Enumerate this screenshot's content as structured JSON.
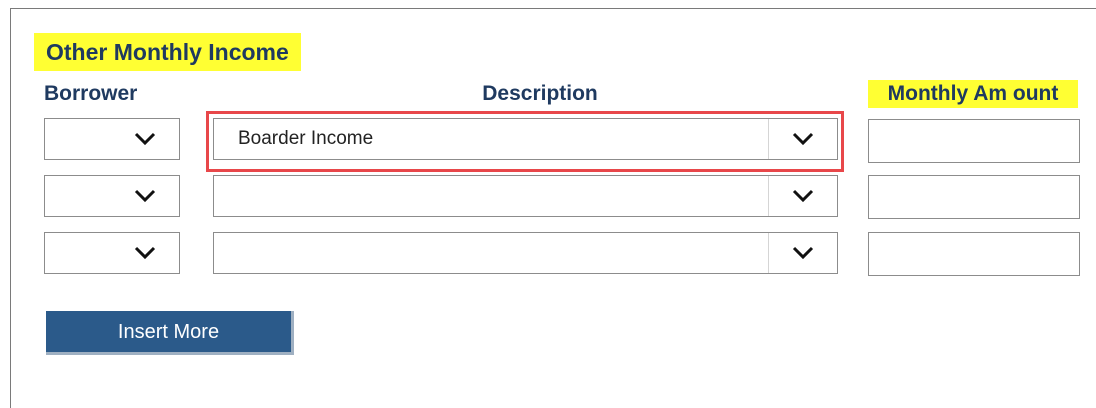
{
  "section": {
    "title": "Other Monthly Income"
  },
  "columns": {
    "borrower": "Borrower",
    "description": "Description",
    "monthly_amount": "Monthly Am ount"
  },
  "rows": [
    {
      "borrower": "",
      "description": "Boarder Income",
      "amount": ""
    },
    {
      "borrower": "",
      "description": "",
      "amount": ""
    },
    {
      "borrower": "",
      "description": "",
      "amount": ""
    }
  ],
  "actions": {
    "insert_more": "Insert More"
  },
  "colors": {
    "highlight_yellow": "#ffff33",
    "heading_navy": "#1f3a60",
    "focus_red": "#e8474a",
    "button_blue": "#2b5a8a"
  },
  "icons": {
    "dropdown": "chevron-down-icon"
  }
}
